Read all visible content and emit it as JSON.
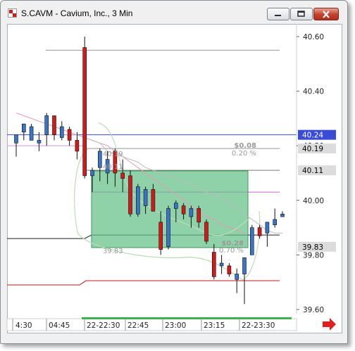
{
  "window": {
    "title": "S.CAVM - Cavium, Inc., 3 Min"
  },
  "colors": {
    "up": "#3a74c4",
    "down": "#d21a1a",
    "box_fill": "#5fbf85",
    "price_line": "#3a4bd8",
    "band": "#bcdcb8",
    "ma": "#e79ab4",
    "grey_line": "#bbbbbb"
  },
  "price_tags": [
    {
      "label": "40.24",
      "value": 40.24,
      "bg": "#3a4bd8",
      "fg": "#ffffff"
    },
    {
      "label": "40.19",
      "value": 40.19,
      "bg": "#dcdcdc",
      "fg": "#000000"
    },
    {
      "label": "40.11",
      "value": 40.11,
      "bg": "#dcdcdc",
      "fg": "#000000"
    },
    {
      "label": "39.83",
      "value": 39.83,
      "bg": "#dcdcdc",
      "fg": "#000000"
    }
  ],
  "annotations": {
    "delta_top": "$0.08",
    "pct_top": "0.20 %",
    "delta_mid": "$0.28",
    "pct_mid": "0.70 %",
    "label_4019": "40.19",
    "label_4011": "40.11",
    "label_3983": "39.83"
  },
  "chart_data": {
    "type": "candlestick",
    "title": "S.CAVM - Cavium, Inc., 3 Min",
    "ylim": [
      39.56,
      40.66
    ],
    "y_ticks": [
      40.6,
      40.4,
      40.2,
      40.0,
      39.8,
      39.6
    ],
    "y_tick_labels": [
      "40.60",
      "40.40",
      "40.20",
      "40.00",
      "39.80",
      "39.60"
    ],
    "x_tick_labels": [
      "4:30",
      "04:45",
      "22-22:30",
      "22:45",
      "23:00",
      "23:15",
      "22-23:30"
    ],
    "horizontal_levels": [
      40.55,
      40.24,
      40.19,
      40.11,
      40.03,
      39.86,
      39.69
    ],
    "candles": [
      {
        "o": 40.21,
        "h": 40.24,
        "l": 40.16,
        "c": 40.24
      },
      {
        "o": 40.25,
        "h": 40.28,
        "l": 40.22,
        "c": 40.28
      },
      {
        "o": 40.22,
        "h": 40.28,
        "l": 40.22,
        "c": 40.27
      },
      {
        "o": 40.21,
        "h": 40.25,
        "l": 40.18,
        "c": 40.22
      },
      {
        "o": 40.24,
        "h": 40.32,
        "l": 40.2,
        "c": 40.31
      },
      {
        "o": 40.31,
        "h": 40.31,
        "l": 40.22,
        "c": 40.24
      },
      {
        "o": 40.23,
        "h": 40.29,
        "l": 40.22,
        "c": 40.27
      },
      {
        "o": 40.26,
        "h": 40.27,
        "l": 40.2,
        "c": 40.22
      },
      {
        "o": 40.22,
        "h": 40.25,
        "l": 40.15,
        "c": 40.18
      },
      {
        "o": 40.56,
        "h": 40.6,
        "l": 40.08,
        "c": 40.09
      },
      {
        "o": 40.09,
        "h": 40.12,
        "l": 40.03,
        "c": 40.11
      },
      {
        "o": 40.12,
        "h": 40.19,
        "l": 40.07,
        "c": 40.18
      },
      {
        "o": 40.1,
        "h": 40.18,
        "l": 40.06,
        "c": 40.15
      },
      {
        "o": 40.18,
        "h": 40.19,
        "l": 40.05,
        "c": 40.1
      },
      {
        "o": 40.1,
        "h": 40.15,
        "l": 40.03,
        "c": 40.08
      },
      {
        "o": 40.09,
        "h": 40.11,
        "l": 39.94,
        "c": 39.95
      },
      {
        "o": 39.95,
        "h": 40.06,
        "l": 39.94,
        "c": 40.05
      },
      {
        "o": 39.98,
        "h": 40.05,
        "l": 39.95,
        "c": 40.04
      },
      {
        "o": 40.04,
        "h": 40.06,
        "l": 39.96,
        "c": 39.96
      },
      {
        "o": 39.92,
        "h": 39.96,
        "l": 39.8,
        "c": 39.82
      },
      {
        "o": 39.83,
        "h": 39.98,
        "l": 39.82,
        "c": 39.97
      },
      {
        "o": 39.97,
        "h": 40.0,
        "l": 39.92,
        "c": 39.99
      },
      {
        "o": 39.98,
        "h": 39.99,
        "l": 39.93,
        "c": 39.95
      },
      {
        "o": 39.94,
        "h": 39.98,
        "l": 39.9,
        "c": 39.97
      },
      {
        "o": 39.97,
        "h": 39.98,
        "l": 39.9,
        "c": 39.92
      },
      {
        "o": 39.92,
        "h": 39.93,
        "l": 39.84,
        "c": 39.85
      },
      {
        "o": 39.81,
        "h": 39.84,
        "l": 39.71,
        "c": 39.72
      },
      {
        "o": 39.76,
        "h": 39.8,
        "l": 39.73,
        "c": 39.77
      },
      {
        "o": 39.76,
        "h": 39.77,
        "l": 39.72,
        "c": 39.73
      },
      {
        "o": 39.71,
        "h": 39.75,
        "l": 39.66,
        "c": 39.73
      },
      {
        "o": 39.73,
        "h": 39.76,
        "l": 39.62,
        "c": 39.79
      },
      {
        "o": 39.8,
        "h": 39.91,
        "l": 39.8,
        "c": 39.9
      },
      {
        "o": 39.9,
        "h": 39.91,
        "l": 39.86,
        "c": 39.87
      },
      {
        "o": 39.88,
        "h": 39.92,
        "l": 39.83,
        "c": 39.92
      },
      {
        "o": 39.91,
        "h": 39.97,
        "l": 39.9,
        "c": 39.93
      },
      {
        "o": 39.94,
        "h": 39.96,
        "l": 39.94,
        "c": 39.95
      }
    ],
    "upper_band": [
      40.24,
      40.24,
      40.24,
      40.24,
      40.24,
      40.24,
      40.23,
      40.22,
      40.21,
      40.18,
      40.17,
      40.16,
      40.15,
      40.14,
      40.12,
      40.11,
      40.1,
      40.09,
      40.08,
      40.07,
      40.06,
      40.04,
      40.03,
      40.02,
      40.01,
      39.99,
      39.97,
      39.95,
      39.93,
      39.91,
      39.89,
      39.88,
      39.88
    ],
    "ma": [
      40.32,
      40.31,
      40.3,
      40.29,
      40.28,
      40.27,
      40.26,
      40.25,
      40.24,
      40.23,
      40.22,
      40.21,
      40.2,
      40.18,
      40.16,
      40.14,
      40.12,
      40.1,
      40.08,
      40.06,
      40.04,
      40.02,
      40.0,
      39.98,
      39.96,
      39.94,
      39.93,
      39.91,
      39.9,
      39.89,
      39.88
    ]
  },
  "footer": {
    "next_arrow": "arrow-right-icon"
  }
}
